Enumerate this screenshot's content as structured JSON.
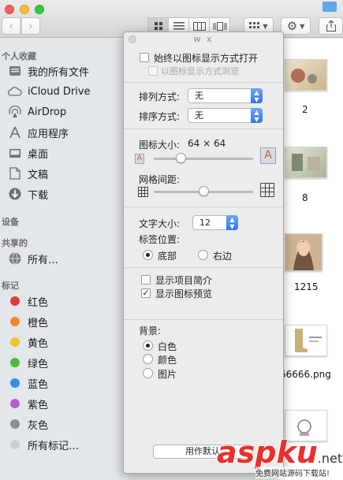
{
  "window": {
    "panel_title": "w x"
  },
  "toolbar": {
    "back_icon": "chevron-left-icon",
    "forward_icon": "chevron-right-icon",
    "views": [
      "icon-view",
      "list-view",
      "column-view",
      "coverflow-view"
    ]
  },
  "sidebar": {
    "favorites_header": "个人收藏",
    "favorites": [
      {
        "label": "我的所有文件",
        "icon": "all-files-icon"
      },
      {
        "label": "iCloud Drive",
        "icon": "cloud-icon"
      },
      {
        "label": "AirDrop",
        "icon": "airdrop-icon"
      },
      {
        "label": "应用程序",
        "icon": "applications-icon"
      },
      {
        "label": "桌面",
        "icon": "desktop-icon"
      },
      {
        "label": "文稿",
        "icon": "documents-icon"
      },
      {
        "label": "下载",
        "icon": "download-icon"
      }
    ],
    "devices_header": "设备",
    "shared_header": "共享的",
    "shared": [
      {
        "label": "所有…",
        "icon": "network-icon"
      }
    ],
    "tags_header": "标记",
    "tags": [
      {
        "label": "红色",
        "color": "#e23b3b"
      },
      {
        "label": "橙色",
        "color": "#f0872e"
      },
      {
        "label": "黄色",
        "color": "#f2c230"
      },
      {
        "label": "绿色",
        "color": "#4cbb3c"
      },
      {
        "label": "蓝色",
        "color": "#3a8ee6"
      },
      {
        "label": "紫色",
        "color": "#b65bd0"
      },
      {
        "label": "灰色",
        "color": "#8e8e8e"
      },
      {
        "label": "所有标记…",
        "color": "#d0d0d0"
      }
    ]
  },
  "panel": {
    "always_open_icon_view": "始终以图标显示方式打开",
    "browse_icon_view": "以图标显示方式浏览",
    "arrange_label": "排列方式:",
    "arrange_value": "无",
    "sort_label": "排序方式:",
    "sort_value": "无",
    "icon_size_label": "图标大小:",
    "icon_size_value": "64 × 64",
    "icon_size_level": 0.27,
    "grid_spacing_label": "网格间距:",
    "grid_spacing_level": 0.5,
    "text_size_label": "文字大小:",
    "text_size_value": "12",
    "label_position_label": "标签位置:",
    "label_bottom": "底部",
    "label_right": "右边",
    "show_item_info": "显示项目简介",
    "show_icon_preview": "显示图标预览",
    "show_icon_preview_checked": true,
    "background_label": "背景:",
    "bg_white": "白色",
    "bg_color": "颜色",
    "bg_picture": "图片",
    "use_default": "用作默认"
  },
  "files": [
    {
      "name": "2"
    },
    {
      "name": "8"
    },
    {
      "name": "1215"
    },
    {
      "name": "66666.png"
    }
  ],
  "watermark": {
    "logo": "aspku",
    "suffix": ".net",
    "tagline": "免费网站源码下载站!"
  }
}
